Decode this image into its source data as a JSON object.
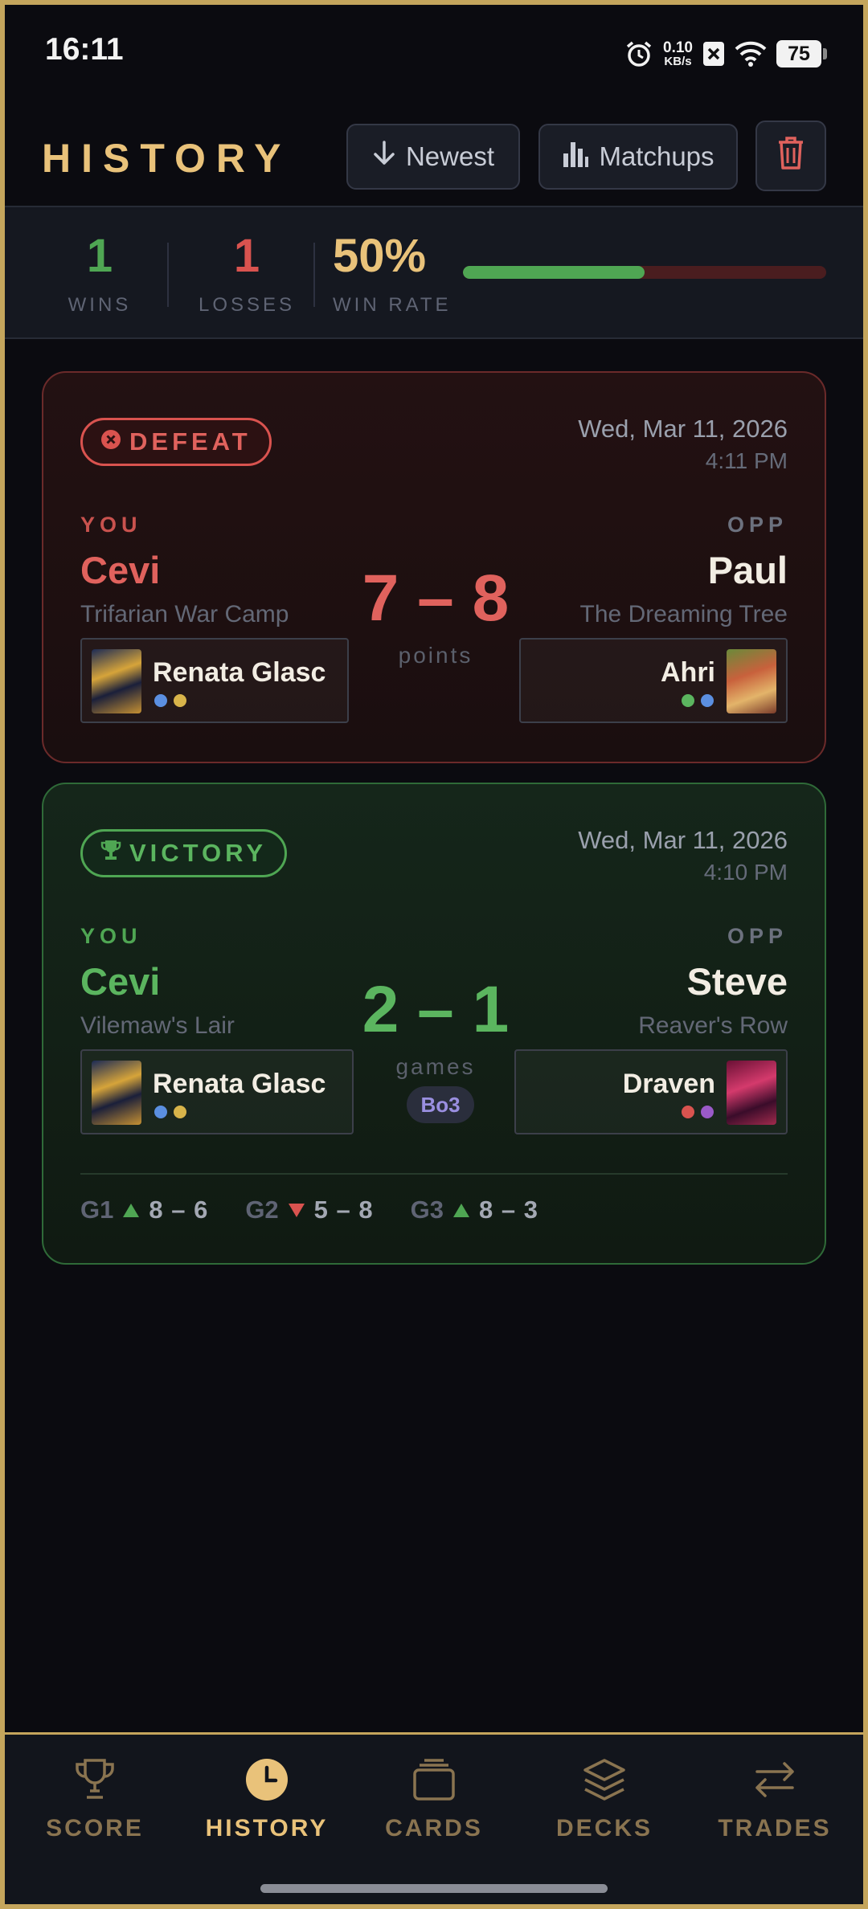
{
  "status_bar": {
    "time": "16:11",
    "net_speed_value": "0.10",
    "net_speed_unit": "KB/s",
    "battery": "75",
    "icons": [
      "alarm-icon",
      "close-box-icon",
      "wifi-icon",
      "battery-icon"
    ]
  },
  "header": {
    "title": "HISTORY",
    "sort_label": "Newest",
    "matchups_label": "Matchups",
    "icons": [
      "arrow-down-icon",
      "bar-chart-icon",
      "trash-icon"
    ]
  },
  "stats": {
    "wins": "1",
    "wins_label": "WINS",
    "losses": "1",
    "losses_label": "LOSSES",
    "win_rate": "50%",
    "win_rate_label": "WIN RATE",
    "win_rate_fraction": 0.5
  },
  "matches": [
    {
      "result": "DEFEAT",
      "date": "Wed, Mar 11, 2026",
      "time": "4:11 PM",
      "you_tag": "YOU",
      "opp_tag": "OPP",
      "you_name": "Cevi",
      "you_venue": "Trifarian War Camp",
      "opp_name": "Paul",
      "opp_venue": "The Dreaming Tree",
      "score": "7 – 8",
      "score_unit": "points",
      "you_champion": "Renata Glasc",
      "opp_champion": "Ahri"
    },
    {
      "result": "VICTORY",
      "date": "Wed, Mar 11, 2026",
      "time": "4:10 PM",
      "you_tag": "YOU",
      "opp_tag": "OPP",
      "you_name": "Cevi",
      "you_venue": "Vilemaw's Lair",
      "opp_name": "Steve",
      "opp_venue": "Reaver's Row",
      "score": "2 – 1",
      "score_unit": "games",
      "format": "Bo3",
      "you_champion": "Renata Glasc",
      "opp_champion": "Draven",
      "games": [
        {
          "label": "G1",
          "result": "win",
          "score": "8 – 6"
        },
        {
          "label": "G2",
          "result": "loss",
          "score": "5 – 8"
        },
        {
          "label": "G3",
          "result": "win",
          "score": "8 – 3"
        }
      ]
    }
  ],
  "colors": {
    "accent_gold": "#e9c27a",
    "win_green": "#4fa653",
    "loss_red": "#d9534f",
    "rune_blue": "#5b8fe0",
    "rune_yellow": "#d8b44a",
    "rune_green": "#5bb55f",
    "rune_red": "#d9534f",
    "rune_purple": "#9a5ac8"
  },
  "nav": {
    "items": [
      {
        "label": "SCORE",
        "icon": "trophy-icon"
      },
      {
        "label": "HISTORY",
        "icon": "clock-icon",
        "active": true
      },
      {
        "label": "CARDS",
        "icon": "cards-icon"
      },
      {
        "label": "DECKS",
        "icon": "layers-icon"
      },
      {
        "label": "TRADES",
        "icon": "swap-arrows-icon"
      }
    ]
  }
}
